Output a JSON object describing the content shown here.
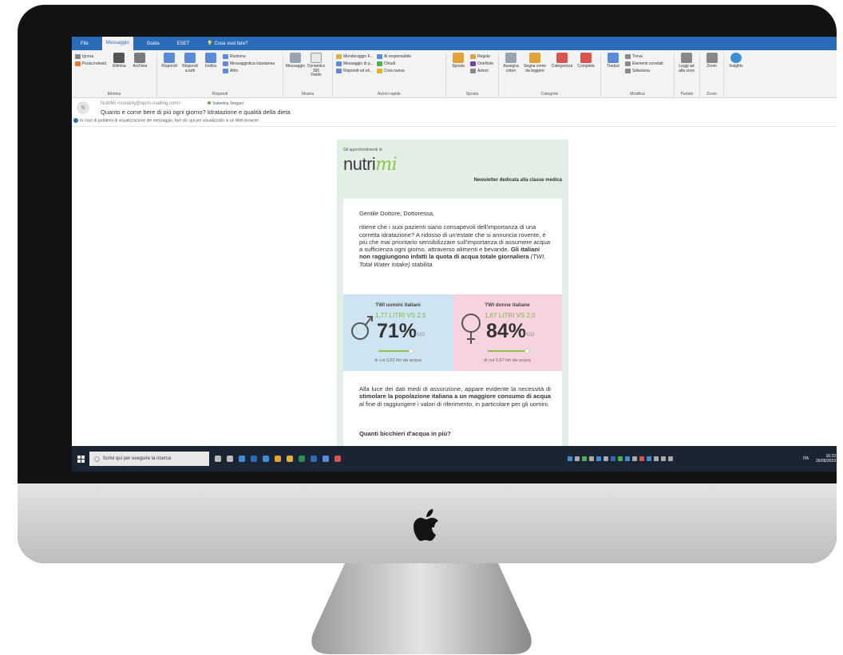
{
  "tabs": [
    "File",
    "Messaggio",
    "Guida",
    "ESET",
    "Cosa vuoi fare?"
  ],
  "ribbon": {
    "elimina": {
      "ignora": "Ignora",
      "posta_indesid": "Posta indesid.",
      "elimina": "Elimina",
      "archivia": "Archivia",
      "label": "Elimina"
    },
    "rispondi": {
      "rispondi": "Rispondi",
      "rispondi_tutti": "Rispondi a tutti",
      "inoltra": "Inoltra",
      "riunione": "Riunione",
      "messaggistica": "Messaggistica istantanea",
      "altro": "Altro",
      "label": "Rispondi"
    },
    "mostra": {
      "messaggio": "Messaggio",
      "dynamics": "Dynamics 365 Fields",
      "label": "Mostra"
    },
    "azioni": {
      "a": "Mondoraggio F...",
      "b": "Messaggio di p...",
      "c": "Rispondi ed eli...",
      "d": "Al responsabile",
      "e": "Chiudi",
      "f": "Crea nuova",
      "label": "Azioni rapide"
    },
    "sposta": {
      "sposta": "Sposta",
      "regole": "Regole",
      "onenote": "OneNote",
      "azioni": "Azioni",
      "label": "Sposta"
    },
    "categorie": {
      "assegna": "Assegna criteri",
      "segna": "Segna come da leggere",
      "categorizza": "Categorizza",
      "completa": "Completa",
      "label": "Categorie"
    },
    "modifica": {
      "traduci": "Traduci",
      "trova": "Trova",
      "elementi": "Elementi correlati",
      "seleziona": "Seleziona",
      "label": "Modifica"
    },
    "parlato": {
      "leggi": "Leggi ad alta voce",
      "label": "Parlato"
    },
    "zoom": {
      "zoom": "Zoom",
      "label": "Zoom"
    },
    "insights": {
      "label": "Insights"
    }
  },
  "header": {
    "avatar": "N",
    "sender": "NutriMi <noreply@sprm-mailing.com>",
    "recipient": "Valentina Vergani",
    "subject": "Quanto e come bere di più ogni giorno? Idratazione e qualità della dieta",
    "info": "In caso di problemi di visualizzazione del messaggio, fare clic qui per visualizzarlo in un Web browser."
  },
  "newsletter": {
    "top": "Gli approfondimenti di",
    "logo_a": "nutri",
    "logo_b": "mi",
    "tagline": "Newsletter dedicata alla classe medica",
    "greeting": "Gentile Dottore, Dottoressa,",
    "p1_a": "ritiene che i suoi pazienti siano consapevoli dell'importanza di una corretta idratazione? A ridosso di un'estate che si annuncia rovente, è più che mai prioritario sensibilizzare sull'importanza di assumere acqua a sufficienza ogni giorno, attraverso alimenti e bevande. ",
    "p1_b": "Gli italiani non raggiungono infatti la quota di acqua totale giornaliera",
    "p1_c": " (TWI, Total Water Intake)",
    "p1_d": " stabilita",
    "male": {
      "title": "TWI uomini italiani",
      "sub": "1,77 LITRI VS 2,5",
      "pct": "71%",
      "h2o": "H2O",
      "note": "di cui 0,62 litri da acqua",
      "fill": 0.71
    },
    "female": {
      "title": "TWI donne italiane",
      "sub": "1,67 LITRI VS 2,0",
      "pct": "84%",
      "h2o": "H2O",
      "note": "di cui 0,67 litri da acqua",
      "fill": 0.84
    },
    "p2_a": "Alla luce dei dati medi di assunzione, appare evidente la necessità di ",
    "p2_b": "stimolare la popolazione italiana a un maggiore consumo di acqua",
    "p2_c": " al fine di raggiungere i valori di riferimento, in particolare per gli uomini.",
    "question": "Quanti bicchieri d'acqua in più?"
  },
  "taskbar": {
    "search": "Scrivi qui per eseguire la ricerca",
    "lang": "ITA",
    "time": "16:23",
    "date": "26/06/2019"
  }
}
